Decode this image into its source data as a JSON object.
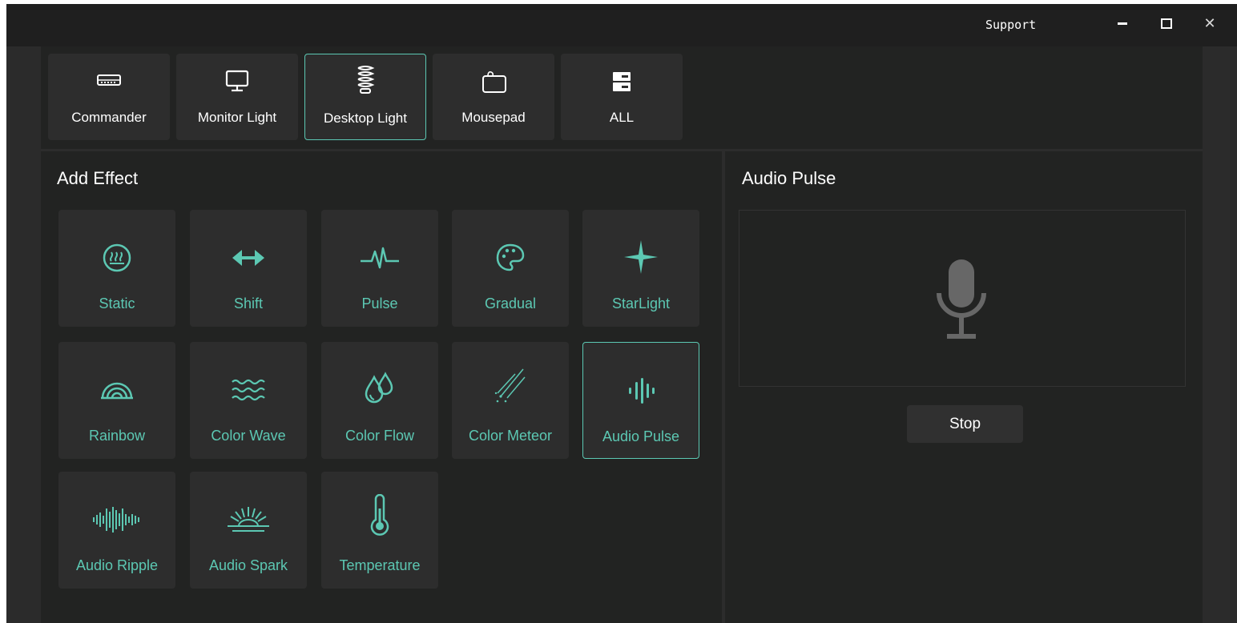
{
  "titlebar": {
    "support_label": "Support"
  },
  "devices": [
    {
      "label": "Commander",
      "icon": "commander-hub-icon",
      "active": false
    },
    {
      "label": "Monitor Light",
      "icon": "monitor-icon",
      "active": false
    },
    {
      "label": "Desktop Light",
      "icon": "coil-lamp-icon",
      "active": true
    },
    {
      "label": "Mousepad",
      "icon": "mousepad-icon",
      "active": false
    },
    {
      "label": "ALL",
      "icon": "device-stack-icon",
      "active": false
    }
  ],
  "add_effect": {
    "title": "Add Effect",
    "effects": [
      {
        "label": "Static",
        "icon": "static-icon"
      },
      {
        "label": "Shift",
        "icon": "double-arrow-icon"
      },
      {
        "label": "Pulse",
        "icon": "pulse-icon"
      },
      {
        "label": "Gradual",
        "icon": "palette-icon"
      },
      {
        "label": "StarLight",
        "icon": "star-icon"
      },
      {
        "label": "Rainbow",
        "icon": "rainbow-icon"
      },
      {
        "label": "Color Wave",
        "icon": "wave-icon"
      },
      {
        "label": "Color Flow",
        "icon": "droplets-icon"
      },
      {
        "label": "Color Meteor",
        "icon": "meteor-icon"
      },
      {
        "label": "Audio Pulse",
        "icon": "audio-bars-icon"
      },
      {
        "label": "Audio Ripple",
        "icon": "audio-ripple-icon"
      },
      {
        "label": "Audio Spark",
        "icon": "audio-spark-icon"
      },
      {
        "label": "Temperature",
        "icon": "thermometer-icon"
      }
    ],
    "selected": "Audio Pulse"
  },
  "effect_panel": {
    "title": "Audio Pulse",
    "icon": "microphone-icon",
    "stop_label": "Stop"
  },
  "colors": {
    "accent": "#5cc8b3",
    "background": "#222322",
    "tile": "#2d2d2d",
    "titlebar": "#1f1f1f"
  }
}
